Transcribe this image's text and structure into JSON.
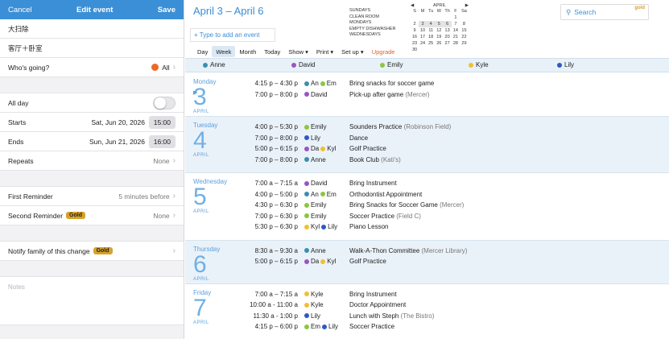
{
  "colors": {
    "brand": "#3b8fd6",
    "anne": "#3a8fb0",
    "david": "#9a55c0",
    "emily": "#8cc63f",
    "kyle": "#f0c030",
    "lily": "#2f57c8",
    "owner_dot": "#ea6a26",
    "gold": "#d7a22a",
    "upgrade": "#e0602a"
  },
  "editor": {
    "cancel": "Cancel",
    "title": "Edit event",
    "save": "Save",
    "name": "大扫除",
    "location": "客厅＋卧室",
    "whos_going_label": "Who's going?",
    "whos_going_value": "All",
    "allday_label": "All day",
    "starts_label": "Starts",
    "starts_date": "Sat, Jun 20, 2026",
    "starts_time": "15:00",
    "ends_label": "Ends",
    "ends_date": "Sun, Jun 21, 2026",
    "ends_time": "16:00",
    "repeats_label": "Repeats",
    "repeats_value": "None",
    "first_reminder_label": "First Reminder",
    "first_reminder_value": "5 minutes before",
    "second_reminder_label": "Second Reminder",
    "second_reminder_value": "None",
    "gold_badge": "Gold",
    "notify_label": "Notify family of this change",
    "notes_placeholder": "Notes"
  },
  "calendar": {
    "range": "April 3 – April 6",
    "add_placeholder": "+ Type to add an event",
    "todo": [
      "SUNDAYS",
      "Clean room",
      "MONDAYS",
      "Empty dishwasher",
      "WEDNESDAYS"
    ],
    "mini": {
      "month": "APRIL",
      "weekdays": [
        "S",
        "M",
        "Tu",
        "W",
        "Th",
        "F",
        "Sa"
      ],
      "weeks": [
        [
          "",
          "",
          "",
          "",
          "",
          "1",
          ""
        ],
        [
          "2",
          "3",
          "4",
          "5",
          "6",
          "7",
          "8"
        ],
        [
          "9",
          "10",
          "11",
          "12",
          "13",
          "14",
          "15"
        ],
        [
          "16",
          "17",
          "18",
          "19",
          "20",
          "21",
          "22"
        ],
        [
          "23",
          "24",
          "25",
          "26",
          "27",
          "28",
          "29"
        ],
        [
          "30",
          "",
          "",
          "",
          "",
          "",
          ""
        ]
      ]
    },
    "search_label": "Search",
    "search_gold": "gold",
    "tabs": [
      "Day",
      "Week",
      "Month",
      "Today",
      "Show ▾",
      "Print ▾",
      "Set up ▾",
      "Upgrade"
    ],
    "people": [
      "Anne",
      "David",
      "Emily",
      "Kyle",
      "Lily"
    ],
    "days": [
      {
        "weekday": "Monday",
        "num": "3",
        "month": "APRIL",
        "events": [
          {
            "time": "4:15 p – 4:30 p",
            "who": [
              [
                "anne",
                "An"
              ],
              [
                "emily",
                "Em"
              ]
            ],
            "title": "Bring snacks for soccer game",
            "loc": ""
          },
          {
            "time": "7:00 p – 8:00 p",
            "who": [
              [
                "david",
                "David"
              ]
            ],
            "title": "Pick-up after game",
            "loc": "(Mercer)"
          }
        ]
      },
      {
        "weekday": "Tuesday",
        "num": "4",
        "month": "APRIL",
        "events": [
          {
            "time": "4:00 p – 5:30 p",
            "who": [
              [
                "emily",
                "Emily"
              ]
            ],
            "title": "Sounders Practice",
            "loc": "(Robinson Field)"
          },
          {
            "time": "7:00 p – 8:00 p",
            "who": [
              [
                "lily",
                "Lily"
              ]
            ],
            "title": "Dance",
            "loc": ""
          },
          {
            "time": "5:00 p – 6:15 p",
            "who": [
              [
                "david",
                "Da"
              ],
              [
                "kyle",
                "Kyl"
              ]
            ],
            "title": "Golf Practice",
            "loc": ""
          },
          {
            "time": "7:00 p – 8:00 p",
            "who": [
              [
                "anne",
                "Anne"
              ]
            ],
            "title": "Book Club",
            "loc": "(Kati's)"
          }
        ]
      },
      {
        "weekday": "Wednesday",
        "num": "5",
        "month": "APRIL",
        "events": [
          {
            "time": "7:00 a – 7:15 a",
            "who": [
              [
                "david",
                "David"
              ]
            ],
            "title": "Bring Instrument",
            "loc": ""
          },
          {
            "time": "4:00 p – 5:00 p",
            "who": [
              [
                "anne",
                "An"
              ],
              [
                "emily",
                "Em"
              ]
            ],
            "title": "Orthodontist Appointment",
            "loc": ""
          },
          {
            "time": "4:30 p – 6:30 p",
            "who": [
              [
                "emily",
                "Emily"
              ]
            ],
            "title": "Bring Snacks for Soccer Game",
            "loc": "(Mercer)"
          },
          {
            "time": "7:00 p – 6:30 p",
            "who": [
              [
                "emily",
                "Emily"
              ]
            ],
            "title": "Soccer Practice",
            "loc": "(Field C)"
          },
          {
            "time": "5:30 p – 6:30 p",
            "who": [
              [
                "kyle",
                "Kyl"
              ],
              [
                "lily",
                "Lily"
              ]
            ],
            "title": "Piano Lesson",
            "loc": ""
          }
        ]
      },
      {
        "weekday": "Thursday",
        "num": "6",
        "month": "APRIL",
        "events": [
          {
            "time": "8:30 a – 9:30 a",
            "who": [
              [
                "anne",
                "Anne"
              ]
            ],
            "title": "Walk-A-Thon Committee",
            "loc": "(Mercer Library)"
          },
          {
            "time": "5:00 p – 6:15 p",
            "who": [
              [
                "david",
                "Da"
              ],
              [
                "kyle",
                "Kyl"
              ]
            ],
            "title": "Golf Practice",
            "loc": ""
          }
        ]
      },
      {
        "weekday": "Friday",
        "num": "7",
        "month": "APRIL",
        "events": [
          {
            "time": "7:00 a – 7:15 a",
            "who": [
              [
                "kyle",
                "Kyle"
              ]
            ],
            "title": "Bring Instrument",
            "loc": ""
          },
          {
            "time": "10:00 a - 11:00 a",
            "who": [
              [
                "kyle",
                "Kyle"
              ]
            ],
            "title": "Doctor Appointment",
            "loc": ""
          },
          {
            "time": "11:30 a - 1:00 p",
            "who": [
              [
                "lily",
                "Lily"
              ]
            ],
            "title": "Lunch with Steph",
            "loc": "(The Bistro)"
          },
          {
            "time": "4:15 p – 6:00 p",
            "who": [
              [
                "emily",
                "Em"
              ],
              [
                "lily",
                "Lily"
              ]
            ],
            "title": "Soccer Practice",
            "loc": ""
          }
        ]
      }
    ]
  }
}
